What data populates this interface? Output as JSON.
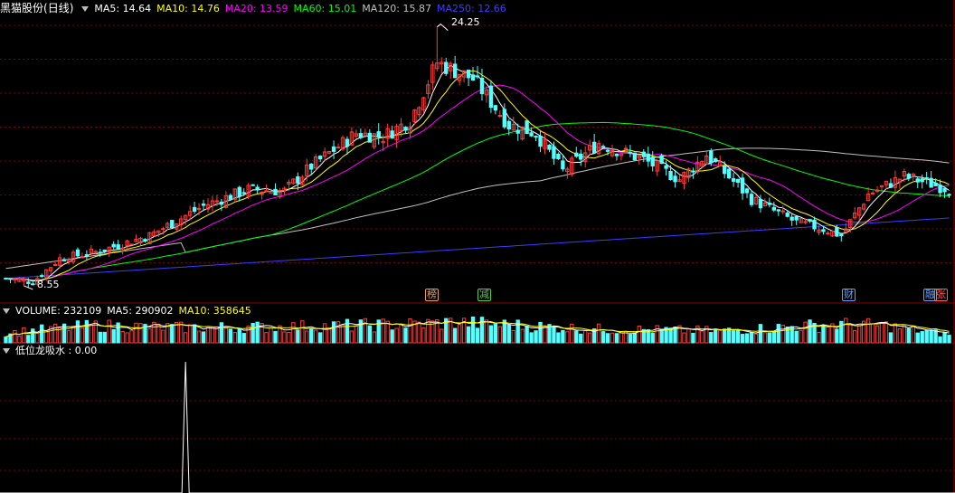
{
  "stock": {
    "name": "黑猫股份",
    "period": "(日线)"
  },
  "ma_legend": [
    {
      "label": "MA5: 14.64",
      "color": "#ffffff"
    },
    {
      "label": "MA10: 14.76",
      "color": "#ffff00"
    },
    {
      "label": "MA20: 13.59",
      "color": "#ff00ff"
    },
    {
      "label": "MA60: 15.01",
      "color": "#00ff00"
    },
    {
      "label": "MA120: 15.87",
      "color": "#c0c0c0"
    },
    {
      "label": "MA250: 12.66",
      "color": "#3c3cff"
    }
  ],
  "price_annotations": {
    "high": "24.25",
    "low": "8.55"
  },
  "event_markers": [
    {
      "text": "榜",
      "color": "#e8a050"
    },
    {
      "text": "减",
      "color": "#4cd04c"
    },
    {
      "text": "财",
      "color": "#5fa0ff"
    },
    {
      "text": "融",
      "color": "#5fa0ff"
    },
    {
      "text": "张",
      "color": "#ff5a5a"
    }
  ],
  "volume_legend": [
    {
      "label": "VOLUME: 232109",
      "color": "#ffffff"
    },
    {
      "label": "MA5: 290902",
      "color": "#ffffff"
    },
    {
      "label": "MA10: 358645",
      "color": "#ffff00"
    }
  ],
  "indicator_legend": {
    "label": "低位龙吸水 : 0.00",
    "color": "#ffffff"
  },
  "colors": {
    "up": "#ff3c3c",
    "down": "#54ffff",
    "grid": "#7a0000",
    "separator": "#8a0000",
    "ma5": "#ffffff",
    "ma10": "#ffff00",
    "ma20": "#ff00ff",
    "ma60": "#00ff00",
    "ma120": "#c0c0c0",
    "ma250": "#3c3cff"
  },
  "chart_data": {
    "type": "candlestick",
    "price_range": [
      8.0,
      25.0
    ],
    "high": 24.25,
    "low": 8.55,
    "final_ma": {
      "ma5": 14.64,
      "ma10": 14.76,
      "ma20": 13.59,
      "ma60": 15.01,
      "ma120": 15.87,
      "ma250": 12.66
    },
    "final_volume": {
      "volume": 232109,
      "ma5": 290902,
      "ma10": 358645
    },
    "close_path": [
      [
        0,
        9.0
      ],
      [
        6,
        8.8
      ],
      [
        12,
        10.2
      ],
      [
        20,
        10.6
      ],
      [
        32,
        11.6
      ],
      [
        44,
        13.4
      ],
      [
        54,
        14.4
      ],
      [
        62,
        14.3
      ],
      [
        68,
        15.8
      ],
      [
        78,
        17.8
      ],
      [
        84,
        17.6
      ],
      [
        90,
        18.6
      ],
      [
        96,
        22.1
      ],
      [
        104,
        21.1
      ],
      [
        112,
        18.3
      ],
      [
        118,
        17.8
      ],
      [
        124,
        15.5
      ],
      [
        132,
        17.2
      ],
      [
        142,
        16.2
      ],
      [
        150,
        15.0
      ],
      [
        156,
        16.5
      ],
      [
        166,
        13.8
      ],
      [
        176,
        12.4
      ],
      [
        182,
        12.0
      ],
      [
        186,
        11.6
      ],
      [
        192,
        14.1
      ],
      [
        200,
        15.2
      ],
      [
        210,
        14.4
      ]
    ],
    "volume_path": [
      [
        0,
        300000
      ],
      [
        10,
        420000
      ],
      [
        20,
        520000
      ],
      [
        40,
        460000
      ],
      [
        60,
        480000
      ],
      [
        90,
        560000
      ],
      [
        100,
        620000
      ],
      [
        130,
        420000
      ],
      [
        160,
        360000
      ],
      [
        176,
        500000
      ],
      [
        186,
        560000
      ],
      [
        196,
        520000
      ],
      [
        210,
        232109
      ]
    ],
    "indicator_signal": {
      "bar_index": 40,
      "value": 1
    }
  }
}
